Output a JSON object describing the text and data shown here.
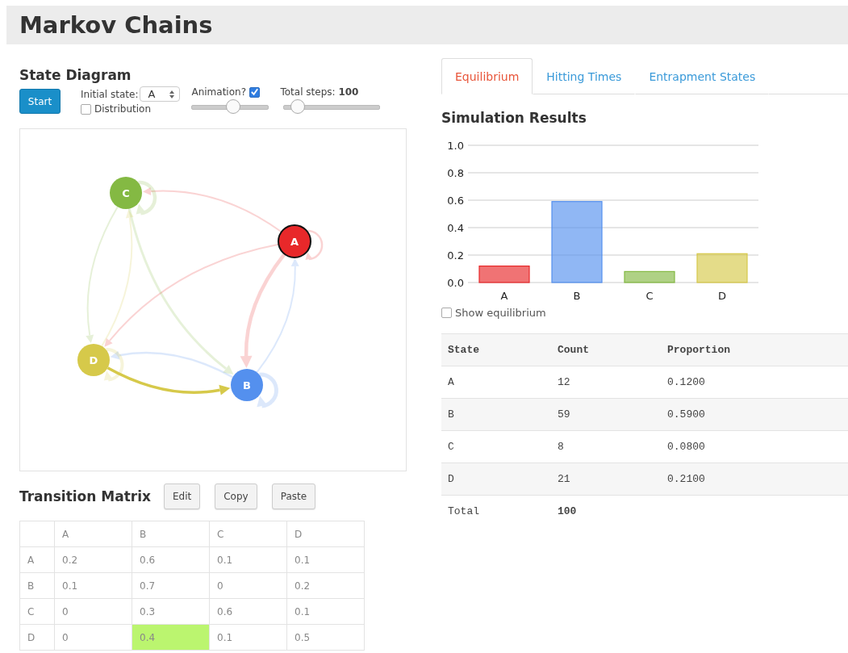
{
  "header": {
    "title": "Markov Chains"
  },
  "state_diagram": {
    "title": "State Diagram",
    "start_button": "Start",
    "initial_state": {
      "label": "Initial state:",
      "value": "A"
    },
    "distribution": {
      "label": "Distribution",
      "checked": false
    },
    "animation": {
      "label": "Animation?",
      "checked": true,
      "level": 0.54
    },
    "total_steps": {
      "label": "Total steps: **100**",
      "level": 0.14
    },
    "nodes": [
      {
        "label": "A",
        "color": "#e8282a",
        "selected": true
      },
      {
        "label": "B",
        "color": "#5490ee",
        "selected": false
      },
      {
        "label": "C",
        "color": "#84b943",
        "selected": false
      },
      {
        "label": "D",
        "color": "#d6c94a",
        "selected": false
      }
    ]
  },
  "transition_matrix": {
    "title": "Transition Matrix",
    "buttons": [
      "Edit",
      "Copy",
      "Paste"
    ],
    "columns": [
      "A",
      "B",
      "C",
      "D"
    ],
    "rows": [
      {
        "label": "A",
        "cells": [
          {
            "value": "0.2",
            "selected": false
          },
          {
            "value": "0.6",
            "selected": false
          },
          {
            "value": "0.1",
            "selected": false
          },
          {
            "value": "0.1",
            "selected": false
          }
        ]
      },
      {
        "label": "B",
        "cells": [
          {
            "value": "0.1",
            "selected": false
          },
          {
            "value": "0.7",
            "selected": false
          },
          {
            "value": "0",
            "selected": false
          },
          {
            "value": "0.2",
            "selected": false
          }
        ]
      },
      {
        "label": "C",
        "cells": [
          {
            "value": "0",
            "selected": false
          },
          {
            "value": "0.3",
            "selected": false
          },
          {
            "value": "0.6",
            "selected": false
          },
          {
            "value": "0.1",
            "selected": false
          }
        ]
      },
      {
        "label": "D",
        "cells": [
          {
            "value": "0",
            "selected": false
          },
          {
            "value": "0.4",
            "selected": true
          },
          {
            "value": "0.1",
            "selected": false
          },
          {
            "value": "0.5",
            "selected": false
          }
        ]
      }
    ]
  },
  "tabs": [
    {
      "label": "Equilibrium",
      "selected": true
    },
    {
      "label": "Hitting Times",
      "selected": false
    },
    {
      "label": "Entrapment States",
      "selected": false
    }
  ],
  "simulation": {
    "title": "Simulation Results",
    "chart_data": {
      "type": "bar",
      "grid": true,
      "categories": [
        "A",
        "B",
        "C",
        "D"
      ],
      "values": [
        0.12,
        0.59,
        0.08,
        0.21
      ],
      "ylim": [
        0,
        1
      ],
      "yticks": [
        {
          "value": 0,
          "label": "0.0"
        },
        {
          "value": 0.2,
          "label": "0.2"
        },
        {
          "value": 0.4,
          "label": "0.4"
        },
        {
          "value": 0.6,
          "label": "0.6"
        },
        {
          "value": 0.8,
          "label": "0.8"
        },
        {
          "value": 1,
          "label": "1.0"
        }
      ]
    },
    "show_equilibrium": {
      "label": "Show equilibrium",
      "checked": false
    },
    "table": {
      "columns": [
        "State",
        "Count",
        "Proportion"
      ],
      "rows": [
        [
          "A",
          "12",
          "0.1200"
        ],
        [
          "B",
          "59",
          "0.5900"
        ],
        [
          "C",
          "8",
          "0.0800"
        ],
        [
          "D",
          "21",
          "0.2100"
        ]
      ],
      "total": {
        "label": "Total",
        "value": "100"
      }
    }
  }
}
